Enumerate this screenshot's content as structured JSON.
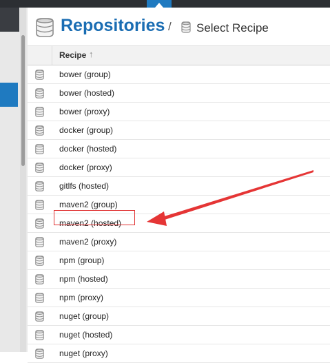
{
  "header": {
    "title": "Repositories",
    "separator": "/",
    "breadcrumb": "Select Recipe"
  },
  "table": {
    "column_header": "Recipe",
    "sort_indicator": "↑",
    "rows": [
      "bower (group)",
      "bower (hosted)",
      "bower (proxy)",
      "docker (group)",
      "docker (hosted)",
      "docker (proxy)",
      "gitlfs (hosted)",
      "maven2 (group)",
      "maven2 (hosted)",
      "maven2 (proxy)",
      "npm (group)",
      "npm (hosted)",
      "npm (proxy)",
      "nuget (group)",
      "nuget (hosted)",
      "nuget (proxy)"
    ],
    "highlighted_row": "maven2 (hosted)"
  },
  "icons": {
    "repo": "database-icon",
    "sort": "sort-ascending-icon",
    "annotation": "red-arrow-annotation"
  },
  "colors": {
    "accent": "#1f7ac0",
    "title": "#1a6db3",
    "topbar": "#2c2f33",
    "annotation": "#e03030"
  }
}
